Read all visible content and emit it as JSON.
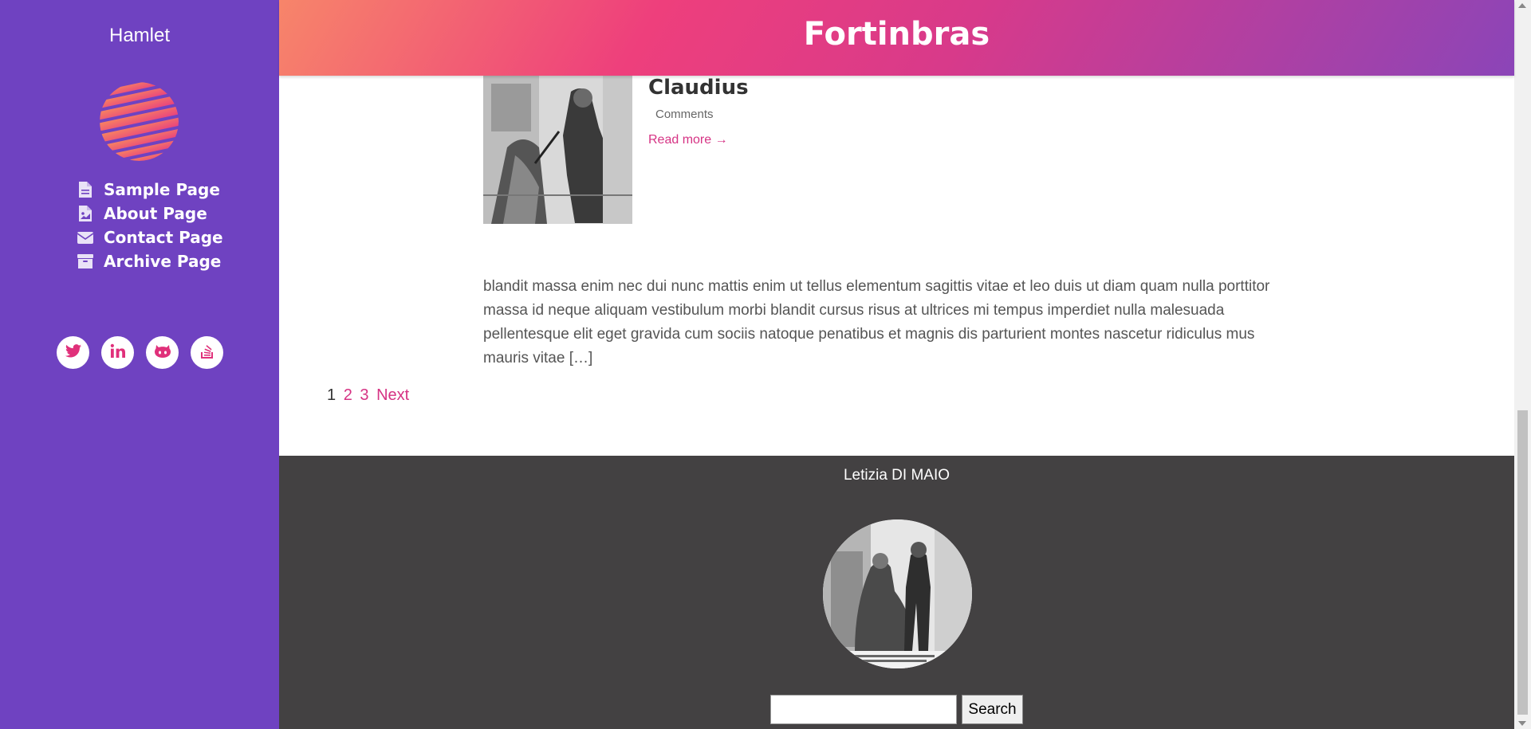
{
  "sidebar": {
    "site_title": "Hamlet",
    "logo_icon": "striped-globe-logo",
    "nav_items": [
      {
        "label": "Sample Page",
        "icon": "document-icon"
      },
      {
        "label": "About Page",
        "icon": "document-image-icon"
      },
      {
        "label": "Contact Page",
        "icon": "envelope-icon"
      },
      {
        "label": "Archive Page",
        "icon": "archive-box-icon"
      }
    ],
    "social": [
      "twitter-icon",
      "linkedin-icon",
      "github-icon",
      "stackoverflow-icon"
    ]
  },
  "header": {
    "title": "Fortinbras"
  },
  "post": {
    "title": "Claudius",
    "comments": "Comments",
    "read_more": "Read more →",
    "excerpt": "blandit massa enim nec dui nunc mattis enim ut tellus elementum sagittis vitae et leo duis ut diam quam nulla porttitor massa id neque aliquam vestibulum morbi blandit cursus risus at ultrices mi tempus imperdiet nulla malesuada pellentesque elit eget gravida cum sociis natoque penatibus et magnis dis parturient montes nascetur ridiculus mus mauris vitae […]"
  },
  "pagination": {
    "current": "1",
    "page2": "2",
    "page3": "3",
    "next": "Next"
  },
  "footer": {
    "author": "Letizia DI MAIO",
    "search_button": "Search",
    "search_placeholder": ""
  },
  "colors": {
    "sidebar_bg": "#6f42c1",
    "accent": "#d63384",
    "footer_bg": "#434142"
  }
}
